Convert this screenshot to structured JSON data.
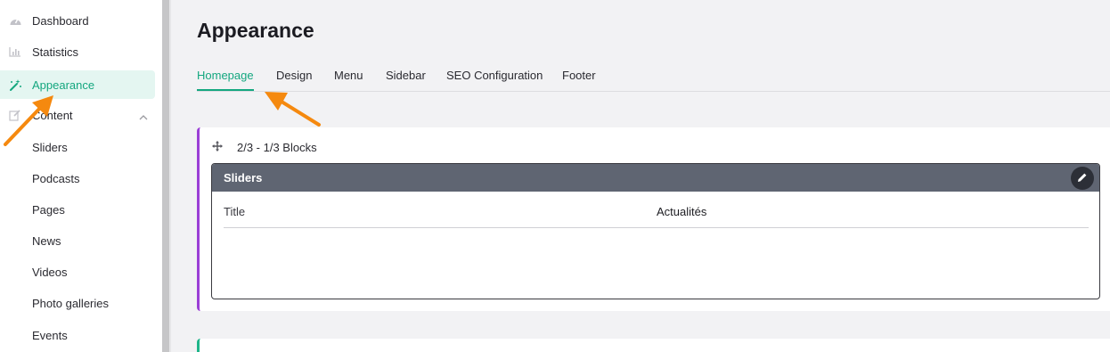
{
  "sidebar": {
    "items": [
      {
        "label": "Dashboard",
        "icon": "gauge-icon"
      },
      {
        "label": "Statistics",
        "icon": "bar-chart-icon"
      },
      {
        "label": "Appearance",
        "icon": "magic-wand-icon",
        "active": true
      },
      {
        "label": "Content",
        "icon": "edit-icon",
        "expanded": true
      },
      {
        "label": "Sliders"
      },
      {
        "label": "Podcasts"
      },
      {
        "label": "Pages"
      },
      {
        "label": "News"
      },
      {
        "label": "Videos"
      },
      {
        "label": "Photo galleries"
      },
      {
        "label": "Events"
      }
    ]
  },
  "main": {
    "title": "Appearance",
    "tabs": [
      {
        "label": "Homepage",
        "active": true
      },
      {
        "label": "Design"
      },
      {
        "label": "Menu"
      },
      {
        "label": "Sidebar"
      },
      {
        "label": "SEO Configuration"
      },
      {
        "label": "Footer"
      }
    ],
    "block": {
      "label": "2/3 - 1/3 Blocks",
      "panel": {
        "title": "Sliders",
        "rows": [
          {
            "key": "Title",
            "value": "Actualités"
          }
        ]
      }
    }
  },
  "colors": {
    "accent": "#14a77f",
    "block_border": "#9b3fd6",
    "panel_header": "#5f6572",
    "annotation_arrow": "#f5890f"
  }
}
